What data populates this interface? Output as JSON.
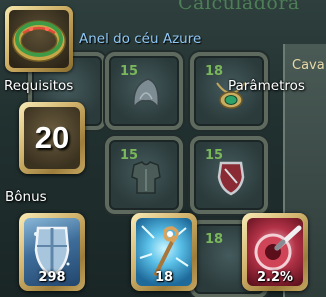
{
  "background": {
    "title": "Calculadora",
    "side_tab": "Cava",
    "slot_levels": [
      "15",
      "15",
      "18",
      "15",
      "18"
    ]
  },
  "tooltip": {
    "item_name": "Anel do céu Azure",
    "requirements_label": "Requisitos",
    "requirement_level": "20",
    "parameters_label": "Parâmetros",
    "bonus_label": "Bônus",
    "bonuses": [
      {
        "value": "298",
        "icon": "shield-icon"
      },
      {
        "value": "18",
        "icon": "staff-icon"
      },
      {
        "value": "2.2%",
        "icon": "critical-icon"
      }
    ]
  },
  "colors": {
    "item_name": "#8fc7f4",
    "gold_frame": "#d2b46d",
    "slot_level": "#79b75a"
  }
}
